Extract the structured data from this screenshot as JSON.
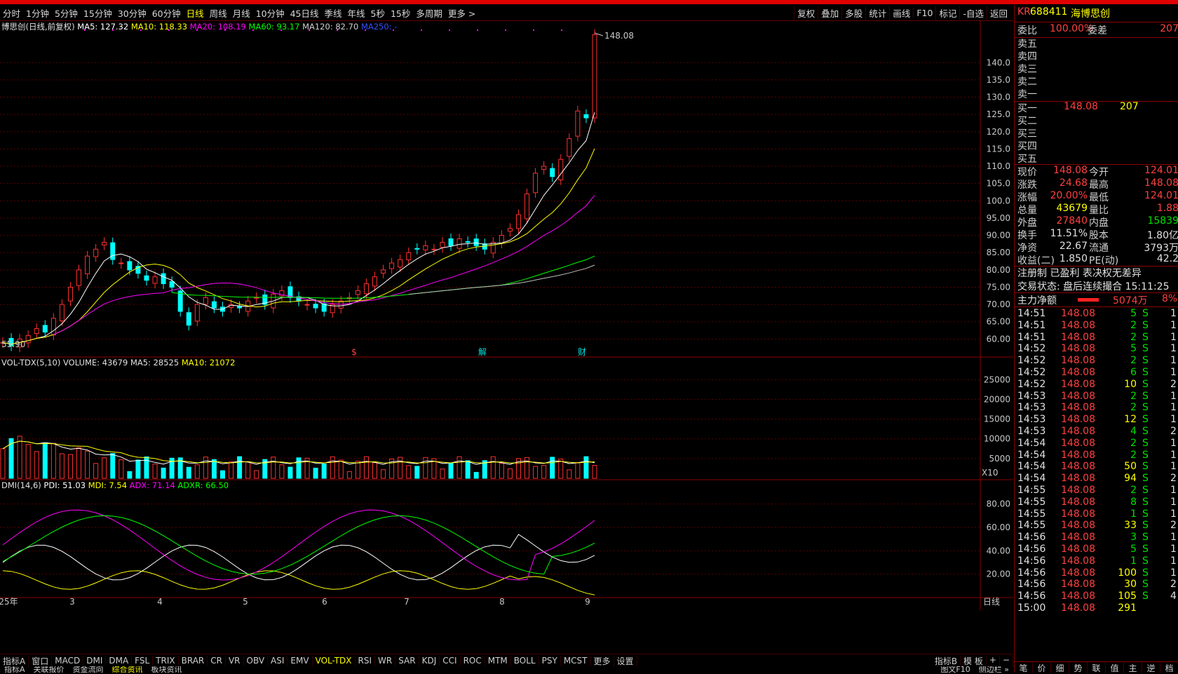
{
  "topbar": {
    "periods": [
      "分时",
      "1分钟",
      "5分钟",
      "15分钟",
      "30分钟",
      "60分钟",
      "日线",
      "周线",
      "月线",
      "10分钟",
      "45日线",
      "季线",
      "年线",
      "5秒",
      "15秒",
      "多周期",
      "更多 >"
    ],
    "active": "日线",
    "right": [
      "复权",
      "叠加",
      "多股",
      "统计",
      "画线",
      "F10",
      "标记",
      "-自选",
      "返回"
    ]
  },
  "main_legend": {
    "name": "博思创(日线,前复权)",
    "ma5": "MA5: 127.32",
    "ma10": "MA10: 118.33",
    "ma20": "MA20: 108.19",
    "ma60": "MA60: 93.17",
    "ma120": "MA120: 82.70",
    "ma250": "MA250: -"
  },
  "high_label": "148.08",
  "low_label": "55.90",
  "event_marks": [
    "$",
    "解",
    "财"
  ],
  "vol_legend": {
    "name": "VOL-TDX(5,10)",
    "volume": "VOLUME: 43679",
    "ma5": "MA5: 28525",
    "ma10": "MA10: 21072"
  },
  "vol_unit": "X10",
  "dmi_legend": {
    "name": "DMI(14,6)",
    "pdi": "PDI: 51.03",
    "mdi": "MDI: 7.54",
    "adx": "ADX: 71.14",
    "adxr": "ADXR: 66.50"
  },
  "price_ticks": [
    "140.0",
    "135.0",
    "130.0",
    "125.0",
    "120.0",
    "115.0",
    "110.0",
    "105.0",
    "100.0",
    "95.00",
    "90.00",
    "85.00",
    "80.00",
    "75.00",
    "70.00",
    "65.00",
    "60.00"
  ],
  "vol_ticks": [
    "25000",
    "20000",
    "15000",
    "10000",
    "5000"
  ],
  "dmi_ticks": [
    "80.00",
    "60.00",
    "40.00",
    "20.00"
  ],
  "x_labels": [
    "25年",
    "3",
    "4",
    "5",
    "6",
    "7",
    "8",
    "9"
  ],
  "x_axis_mode": "日线",
  "colors": {
    "up": "#ff3030",
    "down": "#00ffff",
    "ma5": "#ffffff",
    "ma10": "#ffff00",
    "ma20": "#ff00ff",
    "ma60": "#00ff00",
    "ma120": "#c0c0c0",
    "pdi": "#ffffff",
    "mdi": "#ffff00",
    "adx": "#ff00ff",
    "adxr": "#00ff00"
  },
  "chart_data": {
    "type": "candlestick",
    "series_close": [
      59,
      58,
      60,
      61,
      63,
      62,
      66,
      70,
      75,
      80,
      84,
      86,
      88,
      83,
      82,
      80,
      79,
      77,
      78,
      76,
      75,
      68,
      64,
      70,
      72,
      69,
      68,
      70,
      69,
      71,
      72,
      70,
      73,
      74,
      72,
      71,
      70,
      69,
      68,
      70,
      71,
      72,
      74,
      76,
      78,
      80,
      82,
      83,
      85,
      86,
      87,
      86,
      88,
      87,
      89,
      88,
      87,
      86,
      88,
      90,
      92,
      96,
      102,
      108,
      110,
      107,
      112,
      118,
      126,
      124,
      148.08
    ],
    "price_range": [
      55,
      150
    ],
    "volume_range": [
      0,
      27000
    ],
    "dmi_range": [
      0,
      90
    ],
    "volume_last": 43679
  },
  "quote": {
    "code": "688411",
    "name": "海博思创",
    "tag": "KR",
    "weibi": {
      "label": "委比",
      "value": "100.00%",
      "label2": "委差",
      "value2": "207"
    },
    "sell": [
      {
        "label": "卖五",
        "price": "",
        "vol": ""
      },
      {
        "label": "卖四",
        "price": "",
        "vol": ""
      },
      {
        "label": "卖三",
        "price": "",
        "vol": ""
      },
      {
        "label": "卖二",
        "price": "",
        "vol": ""
      },
      {
        "label": "卖一",
        "price": "",
        "vol": ""
      }
    ],
    "buy": [
      {
        "label": "买一",
        "price": "148.08",
        "vol": "207"
      },
      {
        "label": "买二",
        "price": "",
        "vol": ""
      },
      {
        "label": "买三",
        "price": "",
        "vol": ""
      },
      {
        "label": "买四",
        "price": "",
        "vol": ""
      },
      {
        "label": "买五",
        "price": "",
        "vol": ""
      }
    ],
    "stats": [
      [
        "现价",
        "148.08",
        "今开",
        "124.01"
      ],
      [
        "涨跌",
        "24.68",
        "最高",
        "148.08"
      ],
      [
        "涨幅",
        "20.00%",
        "最低",
        "124.01"
      ],
      [
        "总量",
        "43679",
        "量比",
        "1.88"
      ],
      [
        "外盘",
        "27840",
        "内盘",
        "15839"
      ],
      [
        "换手",
        "11.51%",
        "股本",
        "1.80亿"
      ],
      [
        "净资",
        "22.67",
        "流通",
        "3793万"
      ],
      [
        "收益(二)",
        "1.850",
        "PE(动)",
        "42.2"
      ]
    ],
    "notice": "注册制 已盈利 表决权无差异",
    "status": "交易状态: 盘后连续撮合 15:11:25",
    "main_net": {
      "label": "主力净额",
      "value": "5074万",
      "pct": "8%"
    },
    "ticks": [
      [
        "14:51",
        "148.08",
        "5",
        "S",
        "1"
      ],
      [
        "14:51",
        "148.08",
        "2",
        "S",
        "1"
      ],
      [
        "14:51",
        "148.08",
        "2",
        "S",
        "1"
      ],
      [
        "14:52",
        "148.08",
        "5",
        "S",
        "1"
      ],
      [
        "14:52",
        "148.08",
        "2",
        "S",
        "1"
      ],
      [
        "14:52",
        "148.08",
        "6",
        "S",
        "1"
      ],
      [
        "14:52",
        "148.08",
        "10",
        "S",
        "2"
      ],
      [
        "14:53",
        "148.08",
        "2",
        "S",
        "1"
      ],
      [
        "14:53",
        "148.08",
        "2",
        "S",
        "1"
      ],
      [
        "14:53",
        "148.08",
        "12",
        "S",
        "1"
      ],
      [
        "14:53",
        "148.08",
        "4",
        "S",
        "2"
      ],
      [
        "14:54",
        "148.08",
        "2",
        "S",
        "1"
      ],
      [
        "14:54",
        "148.08",
        "2",
        "S",
        "1"
      ],
      [
        "14:54",
        "148.08",
        "50",
        "S",
        "1"
      ],
      [
        "14:54",
        "148.08",
        "94",
        "S",
        "2"
      ],
      [
        "14:55",
        "148.08",
        "2",
        "S",
        "1"
      ],
      [
        "14:55",
        "148.08",
        "8",
        "S",
        "1"
      ],
      [
        "14:55",
        "148.08",
        "1",
        "S",
        "1"
      ],
      [
        "14:55",
        "148.08",
        "33",
        "S",
        "2"
      ],
      [
        "14:56",
        "148.08",
        "3",
        "S",
        "1"
      ],
      [
        "14:56",
        "148.08",
        "5",
        "S",
        "1"
      ],
      [
        "14:56",
        "148.08",
        "1",
        "S",
        "1"
      ],
      [
        "14:56",
        "148.08",
        "100",
        "S",
        "1"
      ],
      [
        "14:56",
        "148.08",
        "30",
        "S",
        "2"
      ],
      [
        "14:56",
        "148.08",
        "105",
        "S",
        "4"
      ],
      [
        "15:00",
        "148.08",
        "291",
        "",
        ""
      ]
    ],
    "bottom_tabs": [
      "笔",
      "价",
      "细",
      "势",
      "联",
      "值",
      "主",
      "逆",
      "档"
    ]
  },
  "bottom": {
    "indicators": [
      "指标A",
      "窗口",
      "MACD",
      "DMI",
      "DMA",
      "FSL",
      "TRIX",
      "BRAR",
      "CR",
      "VR",
      "OBV",
      "ASI",
      "EMV",
      "VOL-TDX",
      "RSI",
      "WR",
      "SAR",
      "KDJ",
      "CCI",
      "ROC",
      "MTM",
      "BOLL",
      "PSY",
      "MCST",
      "更多",
      "设置"
    ],
    "selected": "VOL-TDX",
    "right": [
      "指标B",
      "模 板",
      "+",
      "−"
    ],
    "tabs": [
      "指标A",
      "关联报价",
      "资金流向",
      "综合资讯",
      "板块资讯"
    ],
    "tabs_selected": "综合资讯",
    "right2": [
      "图文F10",
      "侧边栏 »"
    ]
  }
}
